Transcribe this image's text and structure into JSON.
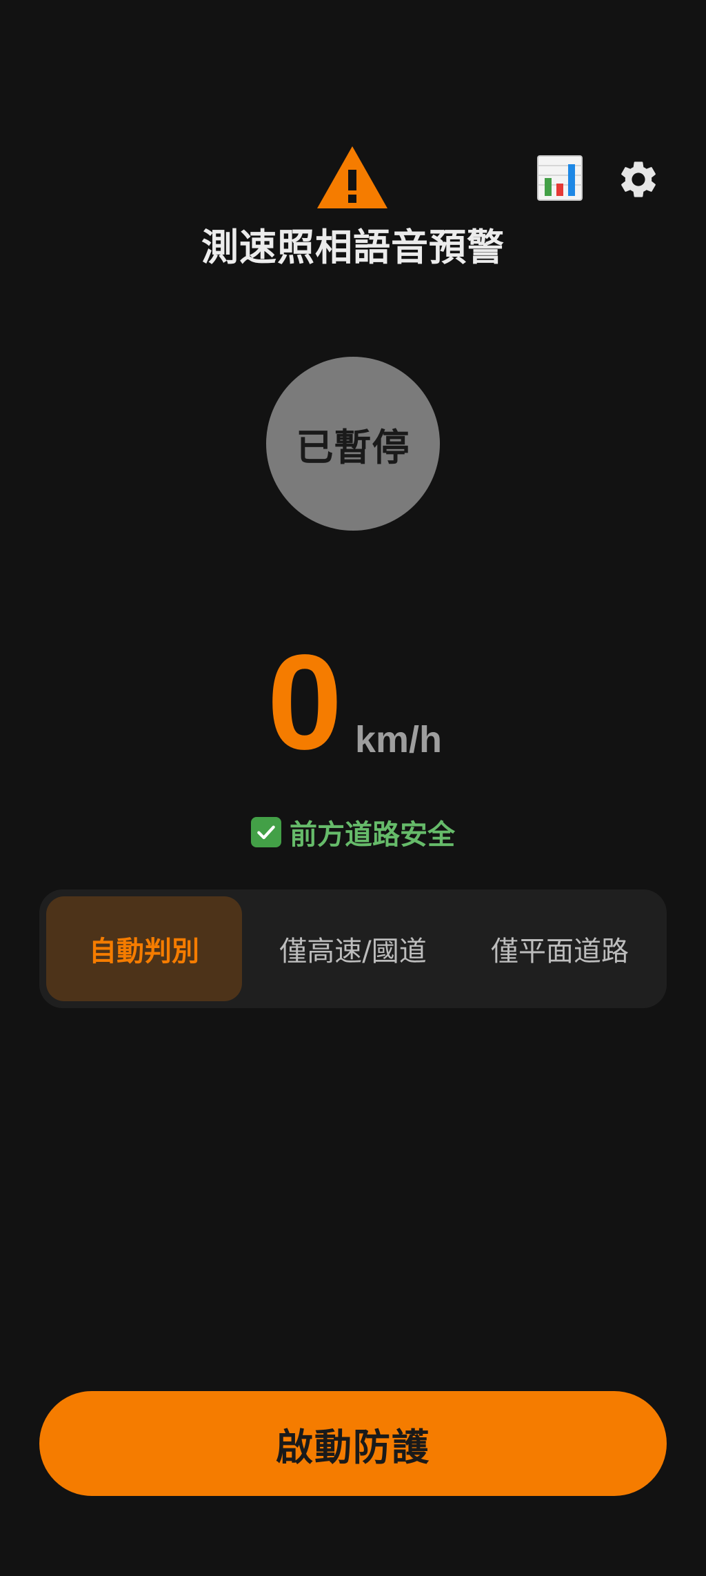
{
  "header": {
    "title": "測速照相語音預警",
    "warning_icon": "warning-triangle-icon",
    "stats_icon": "bar-chart-icon",
    "settings_icon": "gear-icon"
  },
  "status": {
    "label": "已暫停"
  },
  "speed": {
    "value": "0",
    "unit": "km/h"
  },
  "road_status": {
    "icon": "check-mark-icon",
    "text": "前方道路安全"
  },
  "modes": [
    {
      "label": "自動判別",
      "selected": true
    },
    {
      "label": "僅高速/國道",
      "selected": false
    },
    {
      "label": "僅平面道路",
      "selected": false
    }
  ],
  "action": {
    "start_label": "啟動防護"
  },
  "colors": {
    "background": "#121212",
    "accent": "#f57c00",
    "status_circle": "#7b7b7b",
    "safe_green": "#66bb6a",
    "selected_mode_bg": "#4d3319"
  }
}
